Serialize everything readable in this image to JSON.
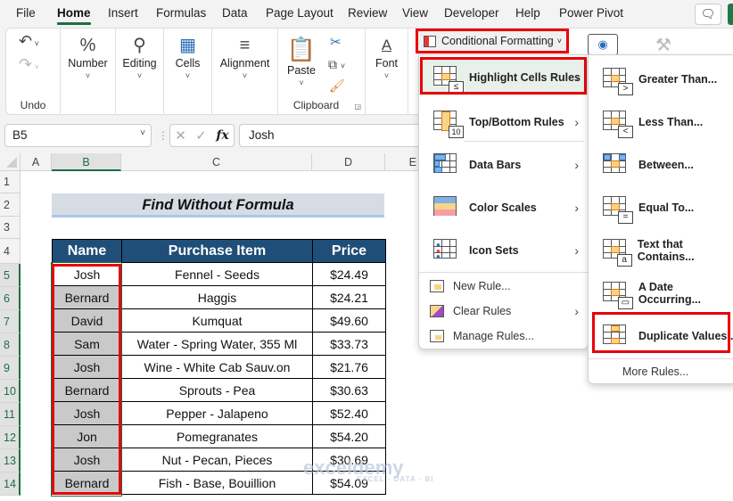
{
  "menubar": {
    "tabs": [
      "File",
      "Home",
      "Insert",
      "Formulas",
      "Data",
      "Page Layout",
      "Review",
      "View",
      "Developer",
      "Help",
      "Power Pivot"
    ],
    "active_tab": "Home"
  },
  "ribbon": {
    "undo_group_label": "Undo",
    "number_label": "Number",
    "editing_label": "Editing",
    "cells_label": "Cells",
    "alignment_label": "Alignment",
    "paste_label": "Paste",
    "clipboard_group_label": "Clipboard",
    "font_label": "Font",
    "conditional_formatting_label": "Conditional Formatting"
  },
  "formula_bar": {
    "name_box": "B5",
    "fx_label": "fx",
    "value": "Josh"
  },
  "sheet": {
    "columns": [
      "A",
      "B",
      "C",
      "D",
      "E"
    ],
    "selected_column": "B",
    "rows": [
      "1",
      "2",
      "3",
      "4",
      "5",
      "6",
      "7",
      "8",
      "9",
      "10",
      "11",
      "12",
      "13",
      "14"
    ],
    "title": "Find Without Formula",
    "table": {
      "headers": [
        "Name",
        "Purchase Item",
        "Price"
      ],
      "rows": [
        {
          "name": "Josh",
          "item": "Fennel - Seeds",
          "price": "$24.49"
        },
        {
          "name": "Bernard",
          "item": "Haggis",
          "price": "$24.21"
        },
        {
          "name": "David",
          "item": "Kumquat",
          "price": "$49.60"
        },
        {
          "name": "Sam",
          "item": "Water - Spring Water, 355 Ml",
          "price": "$33.73"
        },
        {
          "name": "Josh",
          "item": "Wine - White Cab Sauv.on",
          "price": "$21.76"
        },
        {
          "name": "Bernard",
          "item": "Sprouts - Pea",
          "price": "$30.63"
        },
        {
          "name": "Josh",
          "item": "Pepper - Jalapeno",
          "price": "$52.40"
        },
        {
          "name": "Jon",
          "item": "Pomegranates",
          "price": "$54.20"
        },
        {
          "name": "Josh",
          "item": "Nut - Pecan, Pieces",
          "price": "$30.69"
        },
        {
          "name": "Bernard",
          "item": "Fish - Base, Bouillion",
          "price": "$54.09"
        }
      ]
    }
  },
  "cf_menu": {
    "items": [
      {
        "label": "Highlight Cells Rules",
        "submenu": true
      },
      {
        "label": "Top/Bottom Rules",
        "submenu": true
      },
      {
        "label": "Data Bars",
        "submenu": true
      },
      {
        "label": "Color Scales",
        "submenu": true
      },
      {
        "label": "Icon Sets",
        "submenu": true
      }
    ],
    "small_items": [
      {
        "label": "New Rule...",
        "submenu": false
      },
      {
        "label": "Clear Rules",
        "submenu": true
      },
      {
        "label": "Manage Rules...",
        "submenu": false
      }
    ]
  },
  "highlight_submenu": {
    "items": [
      "Greater Than...",
      "Less Than...",
      "Between...",
      "Equal To...",
      "Text that Contains...",
      "A Date Occurring...",
      "Duplicate Values..."
    ],
    "more": "More Rules..."
  },
  "watermark": {
    "brand": "exceldemy",
    "tagline": "EXCEL · DATA · BI"
  }
}
